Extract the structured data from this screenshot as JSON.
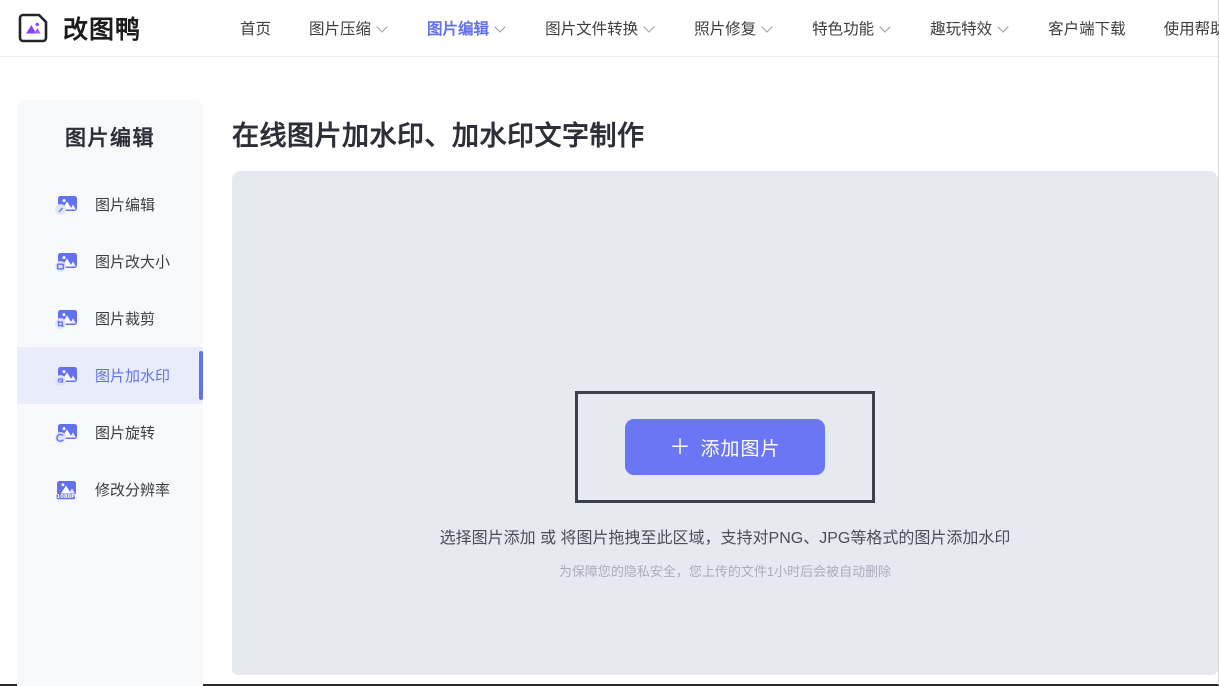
{
  "brand": {
    "name": "改图鸭",
    "logo_icon": "image-logo-icon",
    "accent": "#6370f0"
  },
  "nav": {
    "items": [
      {
        "label": "首页",
        "caret": false,
        "active": false
      },
      {
        "label": "图片压缩",
        "caret": true,
        "active": false
      },
      {
        "label": "图片编辑",
        "caret": true,
        "active": true
      },
      {
        "label": "图片文件转换",
        "caret": true,
        "active": false
      },
      {
        "label": "照片修复",
        "caret": true,
        "active": false
      },
      {
        "label": "特色功能",
        "caret": true,
        "active": false
      },
      {
        "label": "趣玩特效",
        "caret": true,
        "active": false
      },
      {
        "label": "客户端下载",
        "caret": false,
        "active": false
      },
      {
        "label": "使用帮助",
        "caret": false,
        "active": false
      }
    ]
  },
  "sidebar": {
    "title": "图片编辑",
    "items": [
      {
        "label": "图片编辑",
        "icon": "image-edit-icon",
        "badge": "pencil",
        "active": false
      },
      {
        "label": "图片改大小",
        "icon": "image-resize-icon",
        "badge": "resize",
        "active": false
      },
      {
        "label": "图片裁剪",
        "icon": "image-crop-icon",
        "badge": "crop",
        "active": false
      },
      {
        "label": "图片加水印",
        "icon": "image-watermark-icon",
        "badge": "watermark",
        "active": true
      },
      {
        "label": "图片旋转",
        "icon": "image-rotate-icon",
        "badge": "rotate",
        "active": false
      },
      {
        "label": "修改分辨率",
        "icon": "image-resolution-icon",
        "badge": "1080P",
        "active": false
      }
    ]
  },
  "main": {
    "page_title": "在线图片加水印、加水印文字制作",
    "dropzone": {
      "add_button_label": "添加图片",
      "add_button_plus": "＋",
      "hint_primary": "选择图片添加 或 将图片拖拽至此区域，支持对PNG、JPG等格式的图片添加水印",
      "hint_secondary": "为保障您的隐私安全，您上传的文件1小时后会被自动删除",
      "background_color": "#e7e9f1",
      "button_color": "#6b76f5",
      "focus_border_color": "#3c4049"
    }
  }
}
